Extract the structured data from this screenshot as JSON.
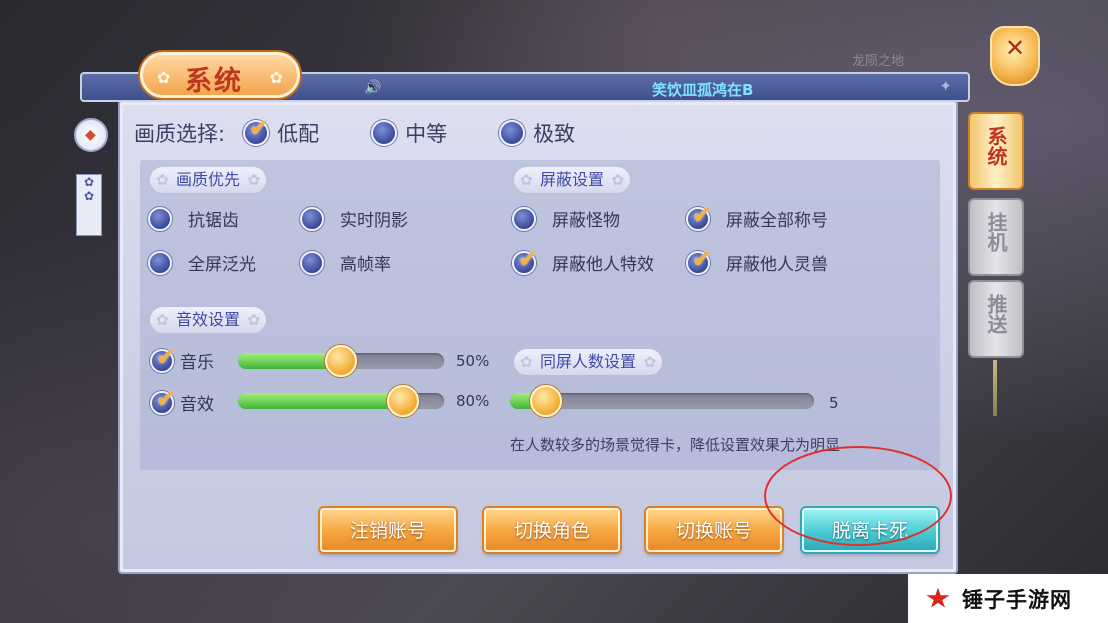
{
  "area_name": "龙陨之地",
  "window": {
    "title": "系统"
  },
  "banner": {
    "speaker_icon": "🔊",
    "marquee": "笑饮皿孤鸿在B"
  },
  "quality": {
    "label": "画质选择:",
    "options": [
      {
        "label": "低配",
        "checked": true
      },
      {
        "label": "中等",
        "checked": false
      },
      {
        "label": "极致",
        "checked": false
      }
    ]
  },
  "quality_priority": {
    "header": "画质优先",
    "options": [
      {
        "label": "抗锯齿",
        "checked": false
      },
      {
        "label": "实时阴影",
        "checked": false
      },
      {
        "label": "全屏泛光",
        "checked": false
      },
      {
        "label": "高帧率",
        "checked": false
      }
    ]
  },
  "block_settings": {
    "header": "屏蔽设置",
    "options": [
      {
        "label": "屏蔽怪物",
        "checked": false
      },
      {
        "label": "屏蔽全部称号",
        "checked": true
      },
      {
        "label": "屏蔽他人特效",
        "checked": true
      },
      {
        "label": "屏蔽他人灵兽",
        "checked": true
      }
    ]
  },
  "audio_settings": {
    "header": "音效设置",
    "music": {
      "label": "音乐",
      "checked": true,
      "value_text": "50%",
      "value": 0.5
    },
    "sfx": {
      "label": "音效",
      "checked": true,
      "value_text": "80%",
      "value": 0.8
    }
  },
  "crowd_settings": {
    "header": "同屏人数设置",
    "value_text": "5",
    "value": 0.12,
    "hint": "在人数较多的场景觉得卡，降低设置效果尤为明显"
  },
  "buttons": {
    "logout": "注销账号",
    "switch_role": "切换角色",
    "switch_account": "切换账号",
    "unstuck": "脱离卡死"
  },
  "side_tabs": [
    {
      "label": "系统",
      "active": true
    },
    {
      "label": "挂机",
      "active": false
    },
    {
      "label": "推送",
      "active": false
    }
  ],
  "watermark": "锤子手游网",
  "colors": {
    "accent_orange": "#f5a53e",
    "accent_teal": "#4ccbd4",
    "panel": "#dcdff0",
    "highlight_ring": "#e0302c"
  }
}
